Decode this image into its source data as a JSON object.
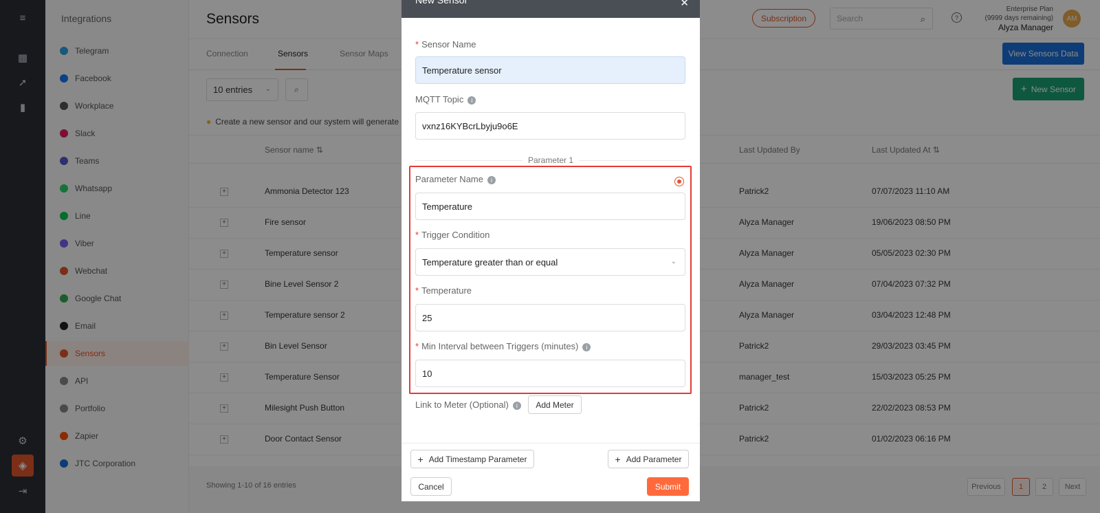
{
  "sidebar": {
    "title": "Integrations",
    "items": [
      {
        "label": "Telegram",
        "color": "#2aa3e0"
      },
      {
        "label": "Facebook",
        "color": "#1877f2"
      },
      {
        "label": "Workplace",
        "color": "#555555"
      },
      {
        "label": "Slack",
        "color": "#e01e5a"
      },
      {
        "label": "Teams",
        "color": "#5059c9"
      },
      {
        "label": "Whatsapp",
        "color": "#25d366"
      },
      {
        "label": "Line",
        "color": "#06c755"
      },
      {
        "label": "Viber",
        "color": "#7360f2"
      },
      {
        "label": "Webchat",
        "color": "#e0562d"
      },
      {
        "label": "Google Chat",
        "color": "#34a853"
      },
      {
        "label": "Email",
        "color": "#222222"
      },
      {
        "label": "Sensors",
        "color": "#e0562d"
      },
      {
        "label": "API",
        "color": "#888888"
      },
      {
        "label": "Portfolio",
        "color": "#888888"
      },
      {
        "label": "Zapier",
        "color": "#ff4f00"
      },
      {
        "label": "JTC Corporation",
        "color": "#1a6ed8"
      }
    ]
  },
  "header": {
    "title": "Sensors",
    "subscription": "Subscription",
    "search_placeholder": "Search",
    "plan": "Enterprise Plan",
    "plan_remaining": "(9999 days remaining)",
    "user": "Alyza Manager",
    "avatar": "AM"
  },
  "tabs": [
    "Connection",
    "Sensors",
    "Sensor Maps"
  ],
  "actions": {
    "view_data": "View Sensors Data",
    "new_sensor": "New Sensor",
    "entries": "10 entries"
  },
  "hint": "Create a new sensor and our system will generate a",
  "table": {
    "headers": {
      "name": "Sensor name",
      "updated_by": "Last Updated By",
      "updated_at": "Last Updated At"
    },
    "rows": [
      {
        "name": "Ammonia Detector 123",
        "by": "Patrick2",
        "at": "07/07/2023 11:10 AM"
      },
      {
        "name": "Fire sensor",
        "by": "Alyza Manager",
        "at": "19/06/2023 08:50 PM"
      },
      {
        "name": "Temperature sensor",
        "by": "Alyza Manager",
        "at": "05/05/2023 02:30 PM"
      },
      {
        "name": "Bine Level Sensor 2",
        "by": "Alyza Manager",
        "at": "07/04/2023 07:32 PM"
      },
      {
        "name": "Temperature sensor 2",
        "by": "Alyza Manager",
        "at": "03/04/2023 12:48 PM"
      },
      {
        "name": "Bin Level Sensor",
        "by": "Patrick2",
        "at": "29/03/2023 03:45 PM"
      },
      {
        "name": "Temperature Sensor",
        "by": "manager_test",
        "at": "15/03/2023 05:25 PM"
      },
      {
        "name": "Milesight Push Button",
        "by": "Patrick2",
        "at": "22/02/2023 08:53 PM"
      },
      {
        "name": "Door Contact Sensor",
        "by": "Patrick2",
        "at": "01/02/2023 06:16 PM"
      }
    ]
  },
  "footer": {
    "showing": "Showing 1-10 of 16 entries",
    "previous": "Previous",
    "pages": [
      "1",
      "2"
    ],
    "next": "Next"
  },
  "modal": {
    "title": "New Sensor",
    "sensor_name_label": "Sensor Name",
    "sensor_name_value": "Temperature sensor",
    "mqtt_label": "MQTT Topic",
    "mqtt_value": "vxnz16KYBcrLbyju9o6E",
    "param_title": "Parameter 1",
    "param_name_label": "Parameter Name",
    "param_name_value": "Temperature",
    "trigger_label": "Trigger Condition",
    "trigger_value": "Temperature greater than or equal",
    "temp_label": "Temperature",
    "temp_value": "25",
    "interval_label": "Min Interval between Triggers (minutes)",
    "interval_value": "10",
    "link_label": "Link to Meter (Optional)",
    "add_meter": "Add Meter",
    "add_timestamp": "Add Timestamp Parameter",
    "add_parameter": "Add Parameter",
    "cancel": "Cancel",
    "submit": "Submit"
  }
}
